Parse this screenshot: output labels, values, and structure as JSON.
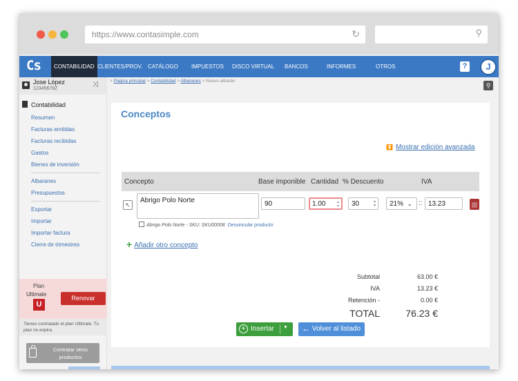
{
  "browser": {
    "url": "https://www.contasimple.com"
  },
  "nav": {
    "logo": "Cs",
    "items": [
      "CONTABILIDAD",
      "CLIENTES/PROV.",
      "CATÁLOGO",
      "IMPUESTOS",
      "DISCO VIRTUAL",
      "BANCOS",
      "INFORMES",
      "OTROS"
    ],
    "active": "CONTABILIDAD",
    "help": "?",
    "avatar": "J"
  },
  "user": {
    "name": "Jose López",
    "id": "12345678Z"
  },
  "sidebar": {
    "section": "Contabilidad",
    "group1": [
      "Resumen",
      "Facturas emitidas",
      "Facturas recibidas",
      "Gastos",
      "Bienes de inversión"
    ],
    "group2": [
      "Albaranes",
      "Presupuestos"
    ],
    "group3": [
      "Exportar",
      "Importar",
      "Importar factura",
      "Cierre de trimestres"
    ]
  },
  "plan": {
    "label": "Plan",
    "name": "Ultimate",
    "badge": "U",
    "renew": "Renovar",
    "note": "Tienes contratado el plan Ultimate. Tu plan no expira.",
    "contract": "Contratar otros productos"
  },
  "breadcrumb": {
    "items": [
      "Página principal",
      "Contabilidad",
      "Albaranes"
    ],
    "current": "Nuevo albarán"
  },
  "main": {
    "title": "Conceptos",
    "advanced_link": "Mostrar edición avanzada",
    "columns": [
      "Concepto",
      "Base imponible",
      "Cantidad",
      "% Descuento",
      "IVA"
    ],
    "row": {
      "concept": "Abrigo Polo Norte",
      "base": "90",
      "quantity": "1.00",
      "discount": "30",
      "iva_rate": "21%",
      "iva_separator": "::",
      "iva_amount": "13.23",
      "sku_text": "Abrigo Polo Norte - SKU: SKU00008",
      "unlink": "Desvincular producto"
    },
    "add_concept": "Añadir otro concepto",
    "totals": [
      {
        "label": "Subtotal",
        "value": "63.00 €"
      },
      {
        "label": "IVA",
        "value": "13.23 €"
      },
      {
        "label": "Retención -",
        "value": "0.00 €"
      }
    ],
    "total": {
      "label": "TOTAL",
      "value": "76.23 €"
    },
    "insert_button": "Insertar",
    "back_button": "Volver al listado"
  },
  "colors": {
    "nav": "#3b79c4",
    "nav_active": "#1f2b3a",
    "link": "#3a6fb0",
    "accent_red": "#c9302c",
    "insert_green": "#3c9e3c",
    "back_blue": "#4f8fd9"
  }
}
